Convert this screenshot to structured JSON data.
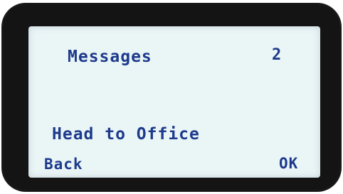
{
  "screen": {
    "title": "Messages",
    "count": "2",
    "message": "Head to Office"
  },
  "softkeys": {
    "left_label": "Back",
    "right_label": "OK"
  },
  "colors": {
    "lcd_background": "#eaf5f6",
    "text": "#1d3a8c",
    "bezel": "#141414"
  }
}
